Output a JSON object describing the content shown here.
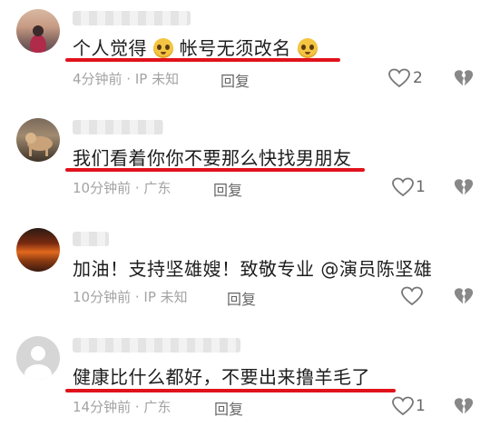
{
  "comments": [
    {
      "text_parts": [
        "个人觉得",
        "帐号无须改名"
      ],
      "emoji": "pleading-face-emoji",
      "meta": "4分钟前 · IP 未知",
      "reply": "回复",
      "likes": "2",
      "underlined": true
    },
    {
      "text": "我们看着你你不要那么快找男朋友",
      "meta": "10分钟前 · 广东",
      "reply": "回复",
      "likes": "1",
      "underlined": true
    },
    {
      "text": "加油！支持坚雄嫂！致敬专业 @演员陈坚雄",
      "meta": "10分钟前 · IP 未知",
      "reply": "回复",
      "likes": "",
      "underlined": false
    },
    {
      "text": "健康比什么都好，不要出来撸羊毛了",
      "meta": "14分钟前 · 广东",
      "reply": "回复",
      "likes": "1",
      "underlined": true
    }
  ],
  "colors": {
    "underline": "#e0121b",
    "meta": "#a3a3a3",
    "text": "#1d1d1d"
  },
  "icons": [
    "heart-outline-icon",
    "broken-heart-icon"
  ]
}
